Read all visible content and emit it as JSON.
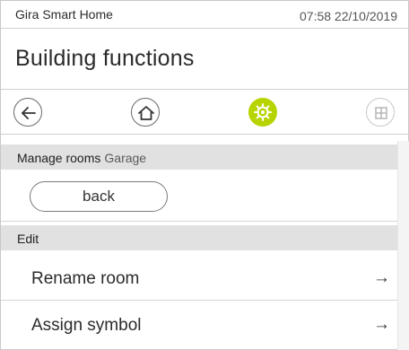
{
  "status_bar": {
    "app_name": "Gira Smart Home",
    "datetime": "07:58 22/10/2019"
  },
  "header": {
    "title": "Building functions"
  },
  "nav": {
    "buttons": [
      {
        "name": "back",
        "icon": "arrow-left-icon"
      },
      {
        "name": "home",
        "icon": "home-icon"
      },
      {
        "name": "settings",
        "icon": "gear-icon",
        "active": true,
        "accent": "#b8d400"
      },
      {
        "name": "grid",
        "icon": "grid-icon"
      }
    ]
  },
  "manage_rooms": {
    "label": "Manage rooms",
    "room": "Garage"
  },
  "back_button": {
    "label": "back"
  },
  "edit_section": {
    "label": "Edit"
  },
  "items": [
    {
      "label": "Rename room",
      "arrow": "→"
    },
    {
      "label": "Assign symbol",
      "arrow": "→"
    }
  ]
}
